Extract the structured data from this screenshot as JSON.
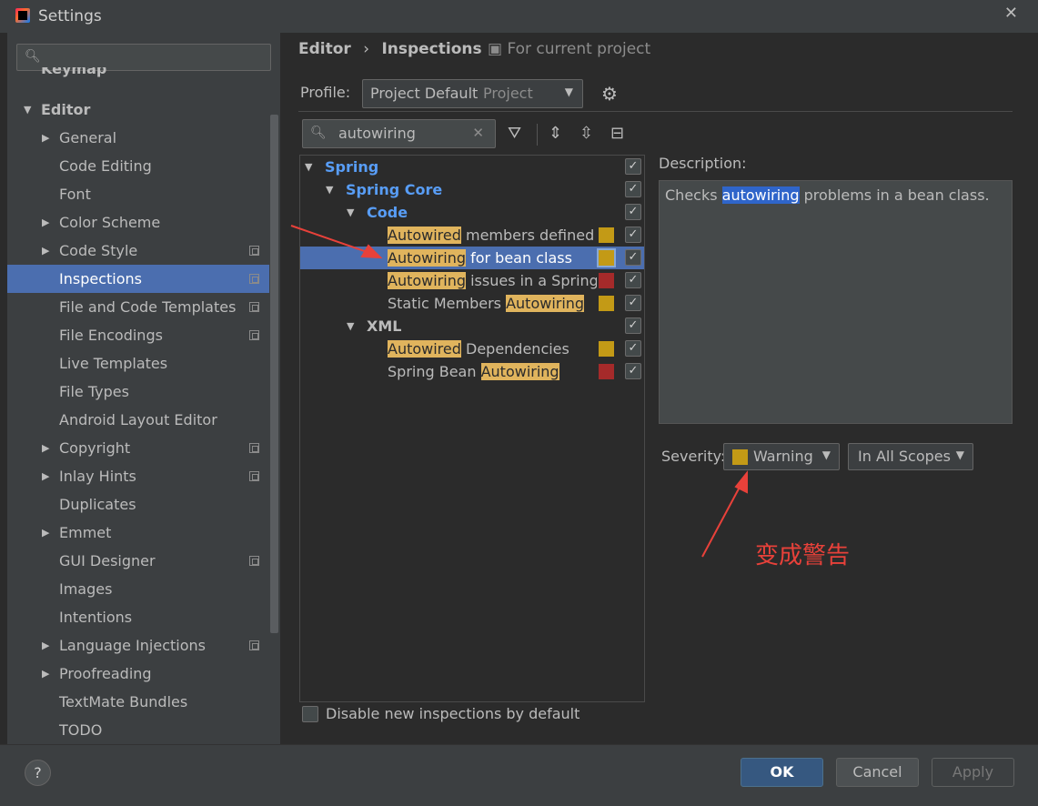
{
  "window": {
    "title": "Settings",
    "close_glyph": "✕"
  },
  "sidebar": {
    "search_placeholder": "",
    "items": [
      {
        "label": "Keymap",
        "indent": 0,
        "arrow": ""
      },
      {
        "label": "Editor",
        "indent": 0,
        "arrow": "▼"
      },
      {
        "label": "General",
        "indent": 1,
        "arrow": "▶"
      },
      {
        "label": "Code Editing",
        "indent": 1,
        "arrow": ""
      },
      {
        "label": "Font",
        "indent": 1,
        "arrow": ""
      },
      {
        "label": "Color Scheme",
        "indent": 1,
        "arrow": "▶"
      },
      {
        "label": "Code Style",
        "indent": 1,
        "arrow": "▶",
        "project": true
      },
      {
        "label": "Inspections",
        "indent": 1,
        "arrow": "",
        "project": true,
        "selected": true
      },
      {
        "label": "File and Code Templates",
        "indent": 1,
        "arrow": "",
        "project": true
      },
      {
        "label": "File Encodings",
        "indent": 1,
        "arrow": "",
        "project": true
      },
      {
        "label": "Live Templates",
        "indent": 1,
        "arrow": ""
      },
      {
        "label": "File Types",
        "indent": 1,
        "arrow": ""
      },
      {
        "label": "Android Layout Editor",
        "indent": 1,
        "arrow": ""
      },
      {
        "label": "Copyright",
        "indent": 1,
        "arrow": "▶",
        "project": true
      },
      {
        "label": "Inlay Hints",
        "indent": 1,
        "arrow": "▶",
        "project": true
      },
      {
        "label": "Duplicates",
        "indent": 1,
        "arrow": ""
      },
      {
        "label": "Emmet",
        "indent": 1,
        "arrow": "▶"
      },
      {
        "label": "GUI Designer",
        "indent": 1,
        "arrow": "",
        "project": true
      },
      {
        "label": "Images",
        "indent": 1,
        "arrow": ""
      },
      {
        "label": "Intentions",
        "indent": 1,
        "arrow": ""
      },
      {
        "label": "Language Injections",
        "indent": 1,
        "arrow": "▶",
        "project": true
      },
      {
        "label": "Proofreading",
        "indent": 1,
        "arrow": "▶"
      },
      {
        "label": "TextMate Bundles",
        "indent": 1,
        "arrow": ""
      },
      {
        "label": "TODO",
        "indent": 1,
        "arrow": ""
      }
    ]
  },
  "breadcrumb": {
    "part1": "Editor",
    "sep": "›",
    "part2": "Inspections",
    "scope": "For current project"
  },
  "profile": {
    "label": "Profile:",
    "value": "Project Default",
    "suffix": "Project"
  },
  "search": {
    "value": "autowiring",
    "clear": "✕"
  },
  "tree": [
    {
      "pre": "",
      "hl": "",
      "post": "Spring",
      "level": 0,
      "arrow": "▼",
      "kind": "group"
    },
    {
      "pre": "",
      "hl": "",
      "post": "Spring Core",
      "level": 1,
      "arrow": "▼",
      "kind": "group"
    },
    {
      "pre": "",
      "hl": "",
      "post": "Code",
      "level": 2,
      "arrow": "▼",
      "kind": "group"
    },
    {
      "pre": "",
      "hl": "Autowired",
      "post": " members defined in",
      "level": 3,
      "arrow": "",
      "kind": "item",
      "severity": "#c39a16"
    },
    {
      "pre": "",
      "hl": "Autowiring",
      "post": " for bean class",
      "level": 3,
      "arrow": "",
      "kind": "item",
      "severity": "#c39a16",
      "selected": true
    },
    {
      "pre": "",
      "hl": "Autowiring",
      "post": " issues in a Spring bean",
      "level": 3,
      "arrow": "",
      "kind": "item",
      "severity": "#a52a2a"
    },
    {
      "pre": "Static Members ",
      "hl": "Autowiring",
      "post": "",
      "level": 3,
      "arrow": "",
      "kind": "item",
      "severity": "#c39a16"
    },
    {
      "pre": "",
      "hl": "",
      "post": "XML",
      "level": 2,
      "arrow": "▼",
      "kind": "xml"
    },
    {
      "pre": "",
      "hl": "Autowired",
      "post": " Dependencies",
      "level": 3,
      "arrow": "",
      "kind": "item",
      "severity": "#c39a16"
    },
    {
      "pre": "Spring Bean ",
      "hl": "Autowiring",
      "post": "",
      "level": 3,
      "arrow": "",
      "kind": "item",
      "severity": "#a52a2a"
    }
  ],
  "description": {
    "label": "Description:",
    "pre": "Checks ",
    "hl": "autowiring",
    "post": " problems in a bean class."
  },
  "severity": {
    "label": "Severity:",
    "value": "Warning",
    "color": "#c39a16",
    "scope": "In All Scopes"
  },
  "annotation": "变成警告",
  "disable_new": {
    "label": "Disable new inspections by default",
    "checked": false
  },
  "buttons": {
    "help": "?",
    "ok": "OK",
    "cancel": "Cancel",
    "apply": "Apply"
  },
  "colors": {
    "selection": "#4b6eaf",
    "highlight": "#e0b45d",
    "group_text": "#589df6",
    "warning": "#c39a16",
    "error": "#a52a2a"
  }
}
